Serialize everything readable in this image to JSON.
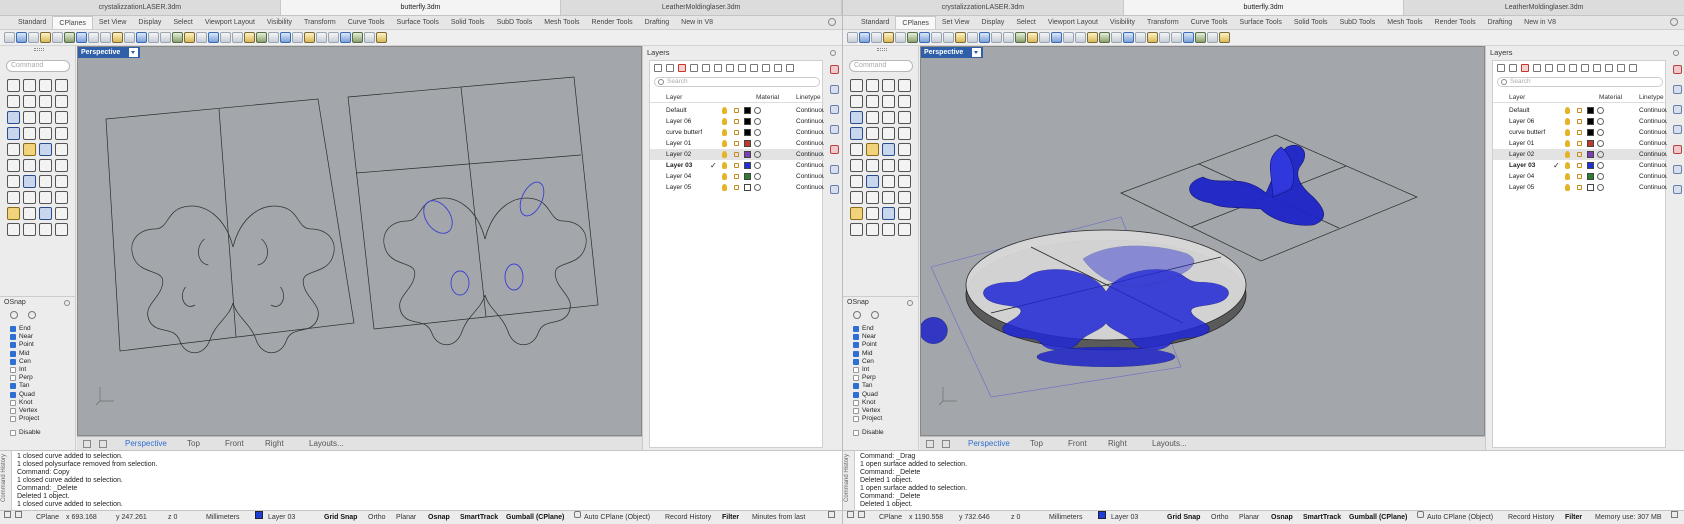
{
  "windows": [
    {
      "doc_tabs": [
        "crystalizzationLASER.3dm",
        "butterfly.3dm",
        "LeatherMoldinglaser.3dm"
      ],
      "active_tab": 1,
      "ribbon_tabs": [
        "Standard",
        "CPlanes",
        "Set View",
        "Display",
        "Select",
        "Viewport Layout",
        "Visibility",
        "Transform",
        "Curve Tools",
        "Surface Tools",
        "Solid Tools",
        "SubD Tools",
        "Mesh Tools",
        "Render Tools",
        "Drafting",
        "New in V8"
      ],
      "active_ribbon": 1,
      "command_placeholder": "Command",
      "viewport_title": "Perspective",
      "viewport_tabs": [
        "Perspective",
        "Top",
        "Front",
        "Right",
        "Layouts..."
      ],
      "osnap_title": "OSnap",
      "snaps": [
        {
          "label": "End",
          "on": true
        },
        {
          "label": "Near",
          "on": true
        },
        {
          "label": "Point",
          "on": true
        },
        {
          "label": "Mid",
          "on": true
        },
        {
          "label": "Cen",
          "on": true
        },
        {
          "label": "Int",
          "on": false
        },
        {
          "label": "Perp",
          "on": false
        },
        {
          "label": "Tan",
          "on": true
        },
        {
          "label": "Quad",
          "on": true
        },
        {
          "label": "Knot",
          "on": false
        },
        {
          "label": "Vertex",
          "on": false
        },
        {
          "label": "Project",
          "on": false
        }
      ],
      "disable_label": "Disable",
      "layers_title": "Layers",
      "layers_search": "Search",
      "layers_headers": {
        "layer": "Layer",
        "material": "Material",
        "linetype": "Linetype"
      },
      "layers": [
        {
          "name": "Default",
          "color": "#000000",
          "linetype": "Continuous"
        },
        {
          "name": "Layer 06",
          "color": "#000000",
          "linetype": "Continuous"
        },
        {
          "name": "curve butterf",
          "color": "#000000",
          "linetype": "Continuous"
        },
        {
          "name": "Layer 01",
          "color": "#c0392b",
          "linetype": "Continuous"
        },
        {
          "name": "Layer 02",
          "color": "#7b3fb5",
          "linetype": "Continuous"
        },
        {
          "name": "Layer 03",
          "color": "#1f2fd6",
          "linetype": "Continuous"
        },
        {
          "name": "Layer 04",
          "color": "#2f7d2f",
          "linetype": "Continuous"
        },
        {
          "name": "Layer 05",
          "color": "#ffffff",
          "linetype": "Continuous"
        }
      ],
      "selected_layer": 4,
      "current_layer": 5,
      "current_check": "✓",
      "history_label": "Command History",
      "history": [
        "1 closed curve added to selection.",
        "1 closed polysurface removed from selection.",
        "Command: Copy",
        "1 closed curve added to selection.",
        "Command: _Delete",
        "Deleted 1 object.",
        "1 closed curve added to selection."
      ],
      "status": {
        "cplane": "CPlane",
        "x": "x 693.168",
        "y": "y 247.261",
        "z": "z 0",
        "units": "Millimeters",
        "layer": "Layer 03",
        "toggles": [
          "Grid Snap",
          "Ortho",
          "Planar",
          "Osnap",
          "SmartTrack",
          "Gumball (CPlane)"
        ],
        "toggles_on": [
          true,
          false,
          false,
          true,
          true,
          true
        ],
        "auto_cplane": "Auto CPlane (Object)",
        "record": "Record History",
        "filter": "Filter",
        "extra": "Minutes from last"
      }
    },
    {
      "doc_tabs": [
        "crystalizzationLASER.3dm",
        "butterfly.3dm",
        "LeatherMoldinglaser.3dm"
      ],
      "active_tab": 1,
      "ribbon_tabs": [
        "Standard",
        "CPlanes",
        "Set View",
        "Display",
        "Select",
        "Viewport Layout",
        "Visibility",
        "Transform",
        "Curve Tools",
        "Surface Tools",
        "Solid Tools",
        "SubD Tools",
        "Mesh Tools",
        "Render Tools",
        "Drafting",
        "New in V8"
      ],
      "active_ribbon": 1,
      "command_placeholder": "Command",
      "viewport_title": "Perspective",
      "viewport_tabs": [
        "Perspective",
        "Top",
        "Front",
        "Right",
        "Layouts..."
      ],
      "osnap_title": "OSnap",
      "snaps": [
        {
          "label": "End",
          "on": true
        },
        {
          "label": "Near",
          "on": true
        },
        {
          "label": "Point",
          "on": true
        },
        {
          "label": "Mid",
          "on": true
        },
        {
          "label": "Cen",
          "on": true
        },
        {
          "label": "Int",
          "on": false
        },
        {
          "label": "Perp",
          "on": false
        },
        {
          "label": "Tan",
          "on": true
        },
        {
          "label": "Quad",
          "on": true
        },
        {
          "label": "Knot",
          "on": false
        },
        {
          "label": "Vertex",
          "on": false
        },
        {
          "label": "Project",
          "on": false
        }
      ],
      "disable_label": "Disable",
      "layers_title": "Layers",
      "layers_search": "Search",
      "layers_headers": {
        "layer": "Layer",
        "material": "Material",
        "linetype": "Linetype"
      },
      "layers": [
        {
          "name": "Default",
          "color": "#000000",
          "linetype": "Continuous"
        },
        {
          "name": "Layer 06",
          "color": "#000000",
          "linetype": "Continuous"
        },
        {
          "name": "curve butterf",
          "color": "#000000",
          "linetype": "Continuous"
        },
        {
          "name": "Layer 01",
          "color": "#c0392b",
          "linetype": "Continuous"
        },
        {
          "name": "Layer 02",
          "color": "#7b3fb5",
          "linetype": "Continuous"
        },
        {
          "name": "Layer 03",
          "color": "#1f2fd6",
          "linetype": "Continuous"
        },
        {
          "name": "Layer 04",
          "color": "#2f7d2f",
          "linetype": "Continuous"
        },
        {
          "name": "Layer 05",
          "color": "#ffffff",
          "linetype": "Continuous"
        }
      ],
      "selected_layer": 4,
      "current_layer": 5,
      "current_check": "✓",
      "history_label": "Command History",
      "history": [
        "Command: _Drag",
        "1 open surface added to selection.",
        "Command: _Delete",
        "Deleted 1 object.",
        "1 open surface added to selection.",
        "Command: _Delete",
        "Deleted 1 object."
      ],
      "status": {
        "cplane": "CPlane",
        "x": "x 1190.558",
        "y": "y 732.646",
        "z": "z 0",
        "units": "Millimeters",
        "layer": "Layer 03",
        "toggles": [
          "Grid Snap",
          "Ortho",
          "Planar",
          "Osnap",
          "SmartTrack",
          "Gumball (CPlane)"
        ],
        "toggles_on": [
          true,
          false,
          false,
          true,
          true,
          true
        ],
        "auto_cplane": "Auto CPlane (Object)",
        "record": "Record History",
        "filter": "Filter",
        "extra": "Memory use: 307 MB"
      }
    }
  ],
  "icons": {
    "toolbar": "rhino-command-icons",
    "viewport_menu": "chevron-down-icon",
    "axes": "world-axes-icon",
    "layer_visible": "lightbulb-icon",
    "layer_lock": "lock-icon",
    "material": "material-sphere-icon"
  },
  "colors": {
    "accent": "#2e5fa8",
    "viewport_bg": "#a3a7ab",
    "selected_geometry": "#1f2fd6"
  }
}
